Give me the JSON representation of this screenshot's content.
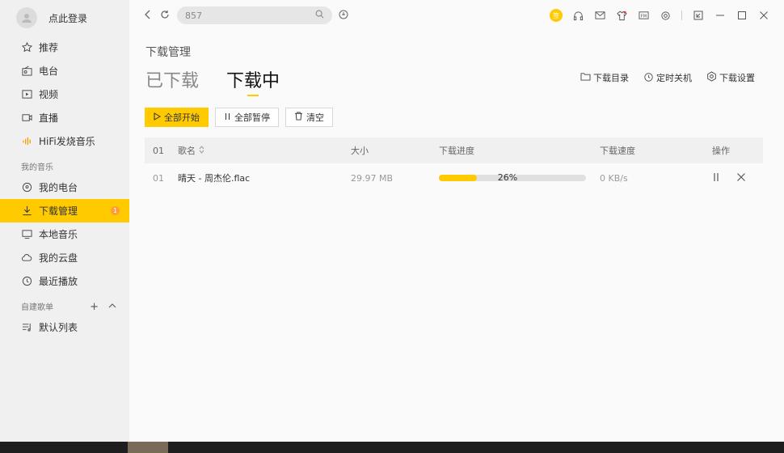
{
  "sidebar": {
    "login_label": "点此登录",
    "items": [
      {
        "label": "推荐",
        "icon": "star-icon"
      },
      {
        "label": "电台",
        "icon": "radio-icon"
      },
      {
        "label": "视频",
        "icon": "video-icon"
      },
      {
        "label": "直播",
        "icon": "live-icon"
      },
      {
        "label": "HiFi发烧音乐",
        "icon": "hifi-icon"
      }
    ],
    "my_music_label": "我的音乐",
    "my_items": [
      {
        "label": "我的电台",
        "icon": "my-radio-icon"
      },
      {
        "label": "下载管理",
        "icon": "download-icon",
        "badge": "1"
      },
      {
        "label": "本地音乐",
        "icon": "monitor-icon"
      },
      {
        "label": "我的云盘",
        "icon": "cloud-icon"
      },
      {
        "label": "最近播放",
        "icon": "clock-icon"
      }
    ],
    "playlists_label": "自建歌单",
    "playlists": [
      {
        "label": "默认列表",
        "icon": "playlist-icon"
      }
    ]
  },
  "topbar": {
    "search_value": "857",
    "vip_label": "签"
  },
  "main": {
    "page_title": "下载管理",
    "tabs": [
      {
        "label": "已下载"
      },
      {
        "label": "下载中"
      }
    ],
    "links": {
      "dir": "下载目录",
      "timer": "定时关机",
      "settings": "下载设置"
    },
    "buttons": {
      "start_all": "全部开始",
      "pause_all": "全部暂停",
      "clear": "清空"
    },
    "table": {
      "headers": {
        "idx": "01",
        "name": "歌名",
        "size": "大小",
        "progress": "下载进度",
        "speed": "下载速度",
        "ops": "操作"
      },
      "rows": [
        {
          "idx": "01",
          "name": "晴天 - 周杰伦.flac",
          "size": "29.97 MB",
          "progress_text": "26%",
          "progress": 0.26,
          "speed": "0 KB/s"
        }
      ]
    }
  },
  "colors": {
    "accent": "#ffcb00",
    "badge": "#ff9c33"
  }
}
